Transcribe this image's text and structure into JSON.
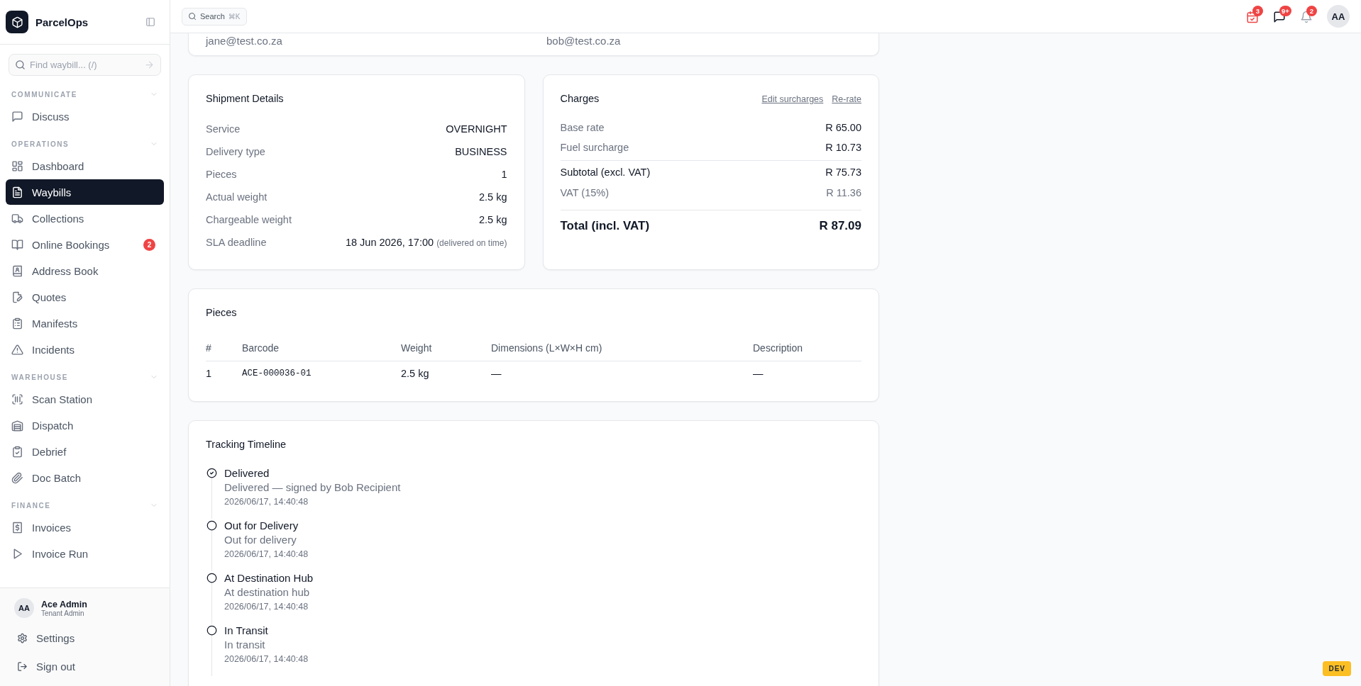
{
  "sidebar": {
    "brand": "ParcelOps",
    "search": {
      "placeholder": "Find waybill... (/)"
    },
    "sections": [
      {
        "title": "COMMUNICATE",
        "items": [
          {
            "label": "Discuss",
            "selected": false
          }
        ]
      },
      {
        "title": "OPERATIONS",
        "items": [
          {
            "label": "Dashboard",
            "selected": false
          },
          {
            "label": "Waybills",
            "selected": true
          },
          {
            "label": "Collections",
            "selected": false
          },
          {
            "label": "Online Bookings",
            "selected": false,
            "badge": "2"
          },
          {
            "label": "Address Book",
            "selected": false
          },
          {
            "label": "Quotes",
            "selected": false
          },
          {
            "label": "Manifests",
            "selected": false
          },
          {
            "label": "Incidents",
            "selected": false
          }
        ]
      },
      {
        "title": "WAREHOUSE",
        "items": [
          {
            "label": "Scan Station",
            "selected": false
          },
          {
            "label": "Dispatch",
            "selected": false
          },
          {
            "label": "Debrief",
            "selected": false
          },
          {
            "label": "Doc Batch",
            "selected": false
          }
        ]
      },
      {
        "title": "FINANCE",
        "items": [
          {
            "label": "Invoices",
            "selected": false
          },
          {
            "label": "Invoice Run",
            "selected": false
          }
        ]
      }
    ],
    "user": {
      "initials": "AA",
      "name": "Ace Admin",
      "role": "Tenant Admin"
    },
    "footer_items": [
      "Settings",
      "Sign out"
    ]
  },
  "topbar": {
    "search": {
      "label": "Search",
      "shortcut": "⌘K"
    },
    "notifications": [
      {
        "badge": "3"
      },
      {
        "badge": "9+"
      },
      {
        "badge": "2"
      }
    ],
    "avatar": "AA"
  },
  "contacts": [
    "jane@test.co.za",
    "bob@test.co.za"
  ],
  "shipment": {
    "title": "Shipment Details",
    "rows": [
      {
        "label": "Service",
        "value": "OVERNIGHT"
      },
      {
        "label": "Delivery type",
        "value": "BUSINESS"
      },
      {
        "label": "Pieces",
        "value": "1"
      },
      {
        "label": "Actual weight",
        "value": "2.5 kg"
      },
      {
        "label": "Chargeable weight",
        "value": "2.5 kg"
      },
      {
        "label": "SLA deadline",
        "value": "18 Jun 2026, 17:00",
        "note": "(delivered on time)"
      }
    ]
  },
  "charges": {
    "title": "Charges",
    "links": [
      "Edit surcharges",
      "Re-rate"
    ],
    "rows": [
      {
        "kind": "line",
        "label": "Base rate",
        "value": "R 65.00"
      },
      {
        "kind": "line",
        "label": "Fuel surcharge",
        "value": "R 10.73"
      },
      {
        "kind": "subtotal",
        "label": "Subtotal (excl. VAT)",
        "value": "R 75.73"
      },
      {
        "kind": "tax",
        "label": "VAT (15%)",
        "value": "R 11.36"
      },
      {
        "kind": "total",
        "label": "Total (incl. VAT)",
        "value": "R 87.09"
      }
    ]
  },
  "pieces": {
    "title": "Pieces",
    "columns": [
      "#",
      "Barcode",
      "Weight",
      "Dimensions (L×W×H cm)",
      "Description"
    ],
    "rows": [
      [
        "1",
        "ACE-000036-01",
        "2.5 kg",
        "—",
        "—"
      ]
    ]
  },
  "timeline": {
    "title": "Tracking Timeline",
    "events": [
      {
        "title": "Delivered",
        "description": "Delivered — signed by Bob Recipient",
        "time": "2026/06/17, 14:40:48",
        "done": true
      },
      {
        "title": "Out for Delivery",
        "description": "Out for delivery",
        "time": "2026/06/17, 14:40:48",
        "done": false
      },
      {
        "title": "At Destination Hub",
        "description": "At destination hub",
        "time": "2026/06/17, 14:40:48",
        "done": false
      },
      {
        "title": "In Transit",
        "description": "In transit",
        "time": "2026/06/17, 14:40:48",
        "done": false
      }
    ]
  },
  "env_badge": "DEV"
}
